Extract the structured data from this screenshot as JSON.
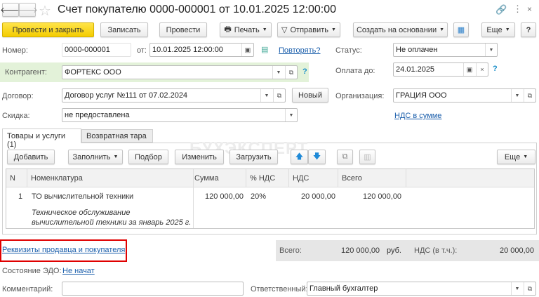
{
  "window": {
    "title": "Счет покупателю 0000-000001 от 10.01.2025 12:00:00"
  },
  "toolbar": {
    "post_close": "Провести и закрыть",
    "save": "Записать",
    "post": "Провести",
    "print": "Печать",
    "send": "Отправить",
    "create_based": "Создать на основании",
    "more": "Еще",
    "help": "?"
  },
  "form": {
    "number_label": "Номер:",
    "number": "0000-000001",
    "date_label": "от:",
    "date": "10.01.2025 12:00:00",
    "repeat_link": "Повторять?",
    "status_label": "Статус:",
    "status": "Не оплачен",
    "contractor_label": "Контрагент:",
    "contractor": "ФОРТЕКС ООО",
    "help": "?",
    "pay_until_label": "Оплата до:",
    "pay_until": "24.01.2025",
    "contract_label": "Договор:",
    "contract": "Договор услуг №111 от 07.02.2024",
    "new_button": "Новый",
    "org_label": "Организация:",
    "org": "ГРАЦИЯ ООО",
    "discount_label": "Скидка:",
    "discount": "не предоставлена",
    "vat_link": "НДС в сумме"
  },
  "tabs": [
    {
      "label": "Товары и услуги (1)"
    },
    {
      "label": "Возвратная тара"
    }
  ],
  "table_toolbar": {
    "add": "Добавить",
    "fill": "Заполнить",
    "select": "Подбор",
    "edit": "Изменить",
    "load": "Загрузить",
    "more": "Еще"
  },
  "watermark": "БУХЭКСПЕРТ",
  "table": {
    "columns": [
      "N",
      "Номенклатура",
      "Сумма",
      "% НДС",
      "НДС",
      "Всего"
    ],
    "rows": [
      {
        "n": "1",
        "item": "ТО вычислительной техники",
        "desc1": "Техническое обслуживание",
        "desc2": "вычислительной техники за январь 2025 г.",
        "sum": "120 000,00",
        "vat_rate": "20%",
        "vat": "20 000,00",
        "total": "120 000,00"
      }
    ]
  },
  "footer": {
    "details_link": "Реквизиты продавца и покупателя",
    "total_label": "Всего:",
    "total": "120 000,00",
    "currency": "руб.",
    "vat_label": "НДС (в т.ч.):",
    "vat": "20 000,00",
    "edo_label": "Состояние ЭДО:",
    "edo_link": "Не начат",
    "comment_label": "Комментарий:",
    "comment": "",
    "responsible_label": "Ответственный:",
    "responsible": "Главный бухгалтер"
  }
}
